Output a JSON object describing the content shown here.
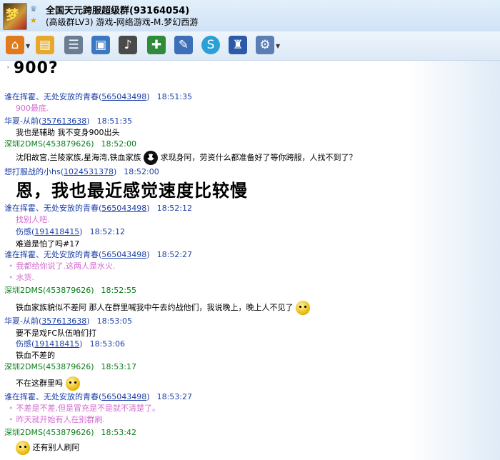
{
  "window": {
    "group_title": "全国天元跨服超级群(93164054)",
    "group_subtitle": "(高级群LV3) 游戏-网络游戏-M.梦幻西游"
  },
  "toolbar": {
    "icons": [
      "home-icon",
      "folder-icon",
      "contacts-icon",
      "window-icon",
      "music-icon",
      "download-icon",
      "tools-icon",
      "sogou-icon",
      "settings-icon",
      "gear-icon"
    ]
  },
  "chat": {
    "messages": [
      {
        "type": "big",
        "text": "900?"
      },
      {
        "type": "header",
        "name": "谁在挥霍、无处安放的青春",
        "qq": "565043498",
        "time": "18:51:35"
      },
      {
        "type": "pink",
        "text": "900最底."
      },
      {
        "type": "header",
        "name": "华夏-从前",
        "qq": "357613638",
        "time": "18:51:35"
      },
      {
        "type": "text",
        "text": "我也是辅助 我不变身900出头"
      },
      {
        "type": "header",
        "name": "深圳2DMS",
        "qq": "453879626",
        "time": "18:52:00",
        "green": true
      },
      {
        "type": "text",
        "text": "沈阳故宫,兰陵家族,星海湾,铁血家族",
        "text2": "求现身阿，劳资什么都准备好了等你跨服，人找不到了？"
      },
      {
        "type": "header",
        "name": "想打服战的小hs",
        "qq": "1024531378",
        "time": "18:52:00"
      },
      {
        "type": "big",
        "text": "恩，我也最近感觉速度比较慢"
      },
      {
        "type": "header",
        "name": "谁在挥霍、无处安放的青春",
        "qq": "565043498",
        "time": "18:52:12"
      },
      {
        "type": "pink",
        "text": "找别人吧."
      },
      {
        "type": "header",
        "name": "伤感",
        "qq": "191418415",
        "time": "18:52:12"
      },
      {
        "type": "text",
        "text": "难道是怕了吗#17"
      },
      {
        "type": "header",
        "name": "谁在挥霍、无处安放的青春",
        "qq": "565043498",
        "time": "18:52:27"
      },
      {
        "type": "pink",
        "text": "我都给你说了.这两人是水火."
      },
      {
        "type": "pink",
        "text": "水货."
      },
      {
        "type": "header",
        "name": "深圳2DMS",
        "qq": "453879626",
        "time": "18:52:55",
        "green": true
      },
      {
        "type": "text",
        "text": "铁血家族貌似不差阿  那人在群里喊我中午去约战他们，我说晚上，晚上人不见了"
      },
      {
        "type": "header",
        "name": "华夏-从前",
        "qq": "357613638",
        "time": "18:53:05"
      },
      {
        "type": "text",
        "text": "要不是戏FC队伍咱们打"
      },
      {
        "type": "header",
        "name": "伤感",
        "qq": "191418415",
        "time": "18:53:06"
      },
      {
        "type": "text",
        "text": "铁血不差的"
      },
      {
        "type": "header",
        "name": "深圳2DMS",
        "qq": "453879626",
        "time": "18:53:17",
        "green": true
      },
      {
        "type": "text",
        "text": "不在这群里吗"
      },
      {
        "type": "header",
        "name": "谁在挥霍、无处安放的青春",
        "qq": "565043498",
        "time": "18:53:27"
      },
      {
        "type": "pink",
        "text": "不差是不差,但是冒充是不是就不清楚了。"
      },
      {
        "type": "pink",
        "text": "昨天就开始有人在别群刷."
      },
      {
        "type": "header",
        "name": "深圳2DMS",
        "qq": "453879626",
        "time": "18:53:42",
        "green": true
      },
      {
        "type": "text",
        "text": "还有别人刷阿"
      }
    ]
  }
}
